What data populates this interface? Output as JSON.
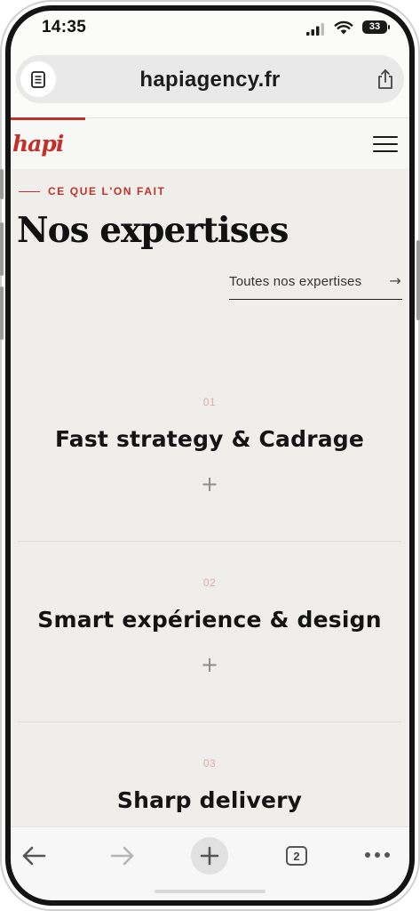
{
  "status_bar": {
    "time": "14:35",
    "battery": "33"
  },
  "browser": {
    "url": "hapiagency.fr",
    "reader_icon": "reader-icon",
    "share_icon": "share-icon"
  },
  "site_header": {
    "logo": "hapi",
    "menu_icon": "hamburger-icon"
  },
  "section": {
    "eyebrow": "CE QUE L'ON FAIT",
    "title": "Nos expertises",
    "all_link": "Toutes nos expertises",
    "all_link_arrow": "→"
  },
  "services": [
    {
      "number": "01",
      "title": "Fast strategy & Cadrage",
      "toggle": "+"
    },
    {
      "number": "02",
      "title": "Smart expérience & design",
      "toggle": "+"
    },
    {
      "number": "03",
      "title": "Sharp delivery"
    }
  ],
  "toolbar": {
    "tabs_count": "2"
  },
  "colors": {
    "accent": "#c0312a",
    "background": "#efeeea",
    "number": "#e4a9a4"
  }
}
